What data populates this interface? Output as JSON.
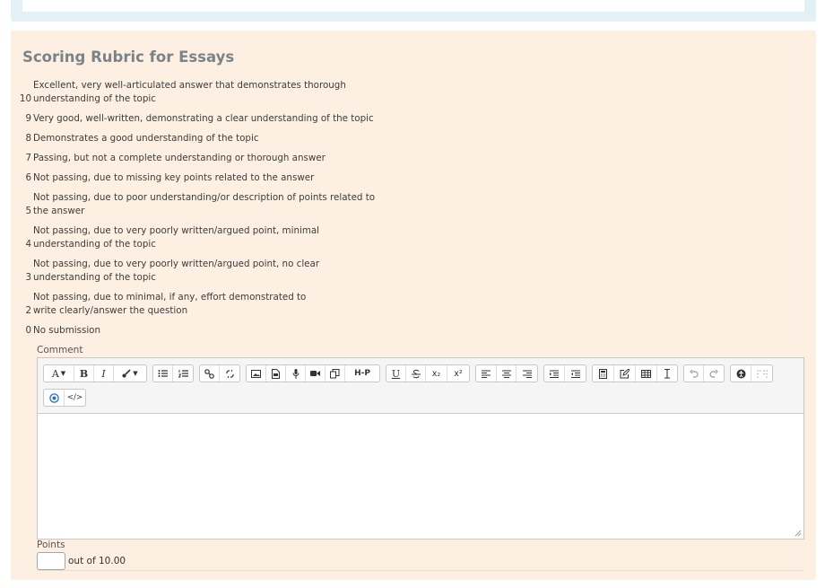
{
  "rubric": {
    "title": "Scoring Rubric for Essays",
    "items": [
      {
        "score": "10",
        "text": "Excellent, very well-articulated answer that demonstrates thorough understanding of the topic"
      },
      {
        "score": "9",
        "text": "Very good, well-written, demonstrating a clear understanding of the topic"
      },
      {
        "score": "8",
        "text": "Demonstrates a good understanding of the topic"
      },
      {
        "score": "7",
        "text": "Passing, but not a complete understanding or thorough answer"
      },
      {
        "score": "6",
        "text": "Not passing, due to missing key points related to the answer"
      },
      {
        "score": "5",
        "text": "Not passing, due to poor understanding/or description of points related to the answer"
      },
      {
        "score": "4",
        "text": "Not passing, due to very poorly written/argued point, minimal understanding of the topic"
      },
      {
        "score": "3",
        "text": "Not passing, due to very poorly written/argued point, no clear understanding of the topic"
      },
      {
        "score": "2",
        "text": "Not passing, due to minimal, if any, effort demonstrated to write clearly/answer the question"
      },
      {
        "score": "0",
        "text": "No submission"
      }
    ]
  },
  "comment": {
    "label": "Comment",
    "value": ""
  },
  "toolbar": {
    "font_button": "A",
    "bold": "B",
    "italic": "I",
    "h5p": "H-P",
    "underline": "U",
    "subscript": "x₂",
    "superscript": "x²",
    "code": "</>"
  },
  "points": {
    "label": "Points",
    "value": "",
    "suffix": "out of 10.00"
  }
}
